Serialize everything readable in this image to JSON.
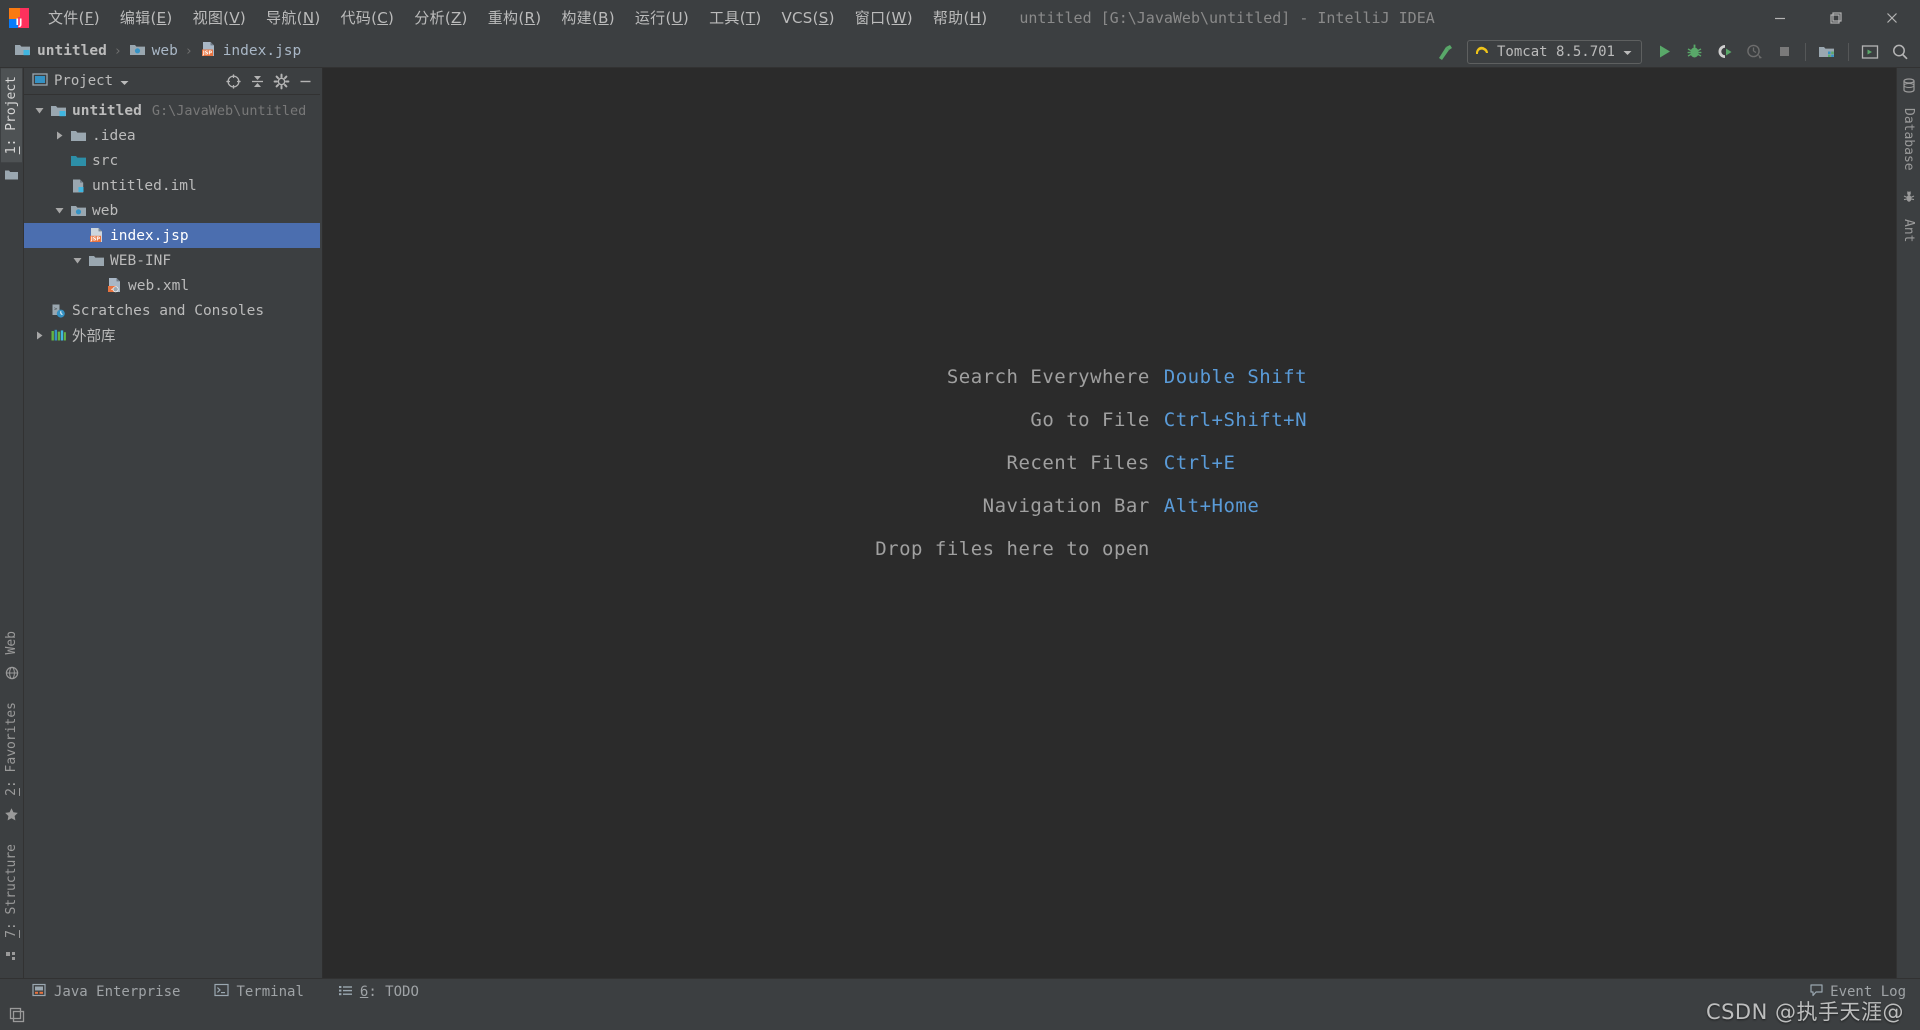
{
  "colors": {
    "chrome": "#3c3f41",
    "editor_bg": "#2b2b2b",
    "selection": "#4b6eaf",
    "text": "#bbbbbb",
    "muted": "#787878",
    "accent_blue": "#5a9bd8",
    "run_green": "#59a869"
  },
  "menubar": {
    "items": [
      {
        "label": "文件",
        "mnemonic": "F"
      },
      {
        "label": "编辑",
        "mnemonic": "E"
      },
      {
        "label": "视图",
        "mnemonic": "V"
      },
      {
        "label": "导航",
        "mnemonic": "N"
      },
      {
        "label": "代码",
        "mnemonic": "C"
      },
      {
        "label": "分析",
        "mnemonic": "Z"
      },
      {
        "label": "重构",
        "mnemonic": "R"
      },
      {
        "label": "构建",
        "mnemonic": "B"
      },
      {
        "label": "运行",
        "mnemonic": "U"
      },
      {
        "label": "工具",
        "mnemonic": "T"
      },
      {
        "label": "VCS",
        "mnemonic": "S"
      },
      {
        "label": "窗口",
        "mnemonic": "W"
      },
      {
        "label": "帮助",
        "mnemonic": "H"
      }
    ],
    "window_title": "untitled [G:\\JavaWeb\\untitled] - IntelliJ IDEA",
    "window_controls": [
      "minimize-icon",
      "restore-icon",
      "close-icon"
    ]
  },
  "navbar": {
    "breadcrumbs": [
      {
        "label": "untitled",
        "icon": "module-folder-icon",
        "bold": true
      },
      {
        "label": "web",
        "icon": "web-folder-icon",
        "bold": false
      },
      {
        "label": "index.jsp",
        "icon": "jsp-file-icon",
        "bold": false
      }
    ],
    "separator": "›",
    "toolbar": {
      "build_label": "build-hammer-icon",
      "run_config": {
        "name": "Tomcat 8.5.701",
        "icon": "tomcat-cat-icon",
        "chevron": "chevron-down-icon"
      },
      "buttons": [
        {
          "name": "run-button",
          "icon": "run-play-icon",
          "enabled": true
        },
        {
          "name": "debug-button",
          "icon": "debug-bug-icon",
          "enabled": true
        },
        {
          "name": "run-with-coverage-button",
          "icon": "coverage-icon",
          "enabled": true
        },
        {
          "name": "profile-button",
          "icon": "profiler-icon",
          "enabled": false
        },
        {
          "name": "stop-button",
          "icon": "stop-square-icon",
          "enabled": false
        },
        {
          "name": "project-structure-button",
          "icon": "project-structure-icon",
          "enabled": true
        },
        {
          "name": "terminal-button",
          "icon": "terminal-window-icon",
          "enabled": true
        },
        {
          "name": "search-everywhere-button",
          "icon": "search-icon",
          "enabled": true
        }
      ]
    }
  },
  "left_strip": {
    "top": [
      {
        "label": "1: Project",
        "mnemonic": "1",
        "icon": "project-folder-icon",
        "active": true
      }
    ],
    "bottom": [
      {
        "label": "7: Structure",
        "mnemonic": "7",
        "icon": "structure-icon",
        "active": false
      },
      {
        "label": "2: Favorites",
        "mnemonic": "2",
        "icon": "star-icon",
        "active": false
      },
      {
        "label": "Web",
        "mnemonic": "",
        "icon": "web-globe-icon",
        "active": false
      }
    ]
  },
  "right_strip": {
    "top": [
      {
        "label": "Database",
        "icon": "database-icon",
        "active": false
      },
      {
        "label": "Ant",
        "icon": "ant-icon",
        "active": false
      }
    ]
  },
  "project_panel": {
    "title": "Project",
    "chevron": "chevron-down-icon",
    "actions": [
      {
        "name": "scroll-from-source-button",
        "icon": "target-crosshair-icon"
      },
      {
        "name": "collapse-all-button",
        "icon": "collapse-all-icon"
      },
      {
        "name": "settings-button",
        "icon": "gear-icon"
      },
      {
        "name": "hide-panel-button",
        "icon": "minimize-dash-icon"
      }
    ],
    "tree": [
      {
        "label": "untitled",
        "sub": "G:\\JavaWeb\\untitled",
        "icon": "module-folder-icon",
        "indent": 0,
        "twist": "expanded",
        "bold": true,
        "selected": false
      },
      {
        "label": ".idea",
        "sub": "",
        "icon": "folder-icon",
        "indent": 1,
        "twist": "collapsed",
        "bold": false,
        "selected": false
      },
      {
        "label": "src",
        "sub": "",
        "icon": "source-folder-icon",
        "indent": 1,
        "twist": "none",
        "bold": false,
        "selected": false
      },
      {
        "label": "untitled.iml",
        "sub": "",
        "icon": "iml-file-icon",
        "indent": 1,
        "twist": "none",
        "bold": false,
        "selected": false
      },
      {
        "label": "web",
        "sub": "",
        "icon": "web-folder-icon",
        "indent": 1,
        "twist": "expanded",
        "bold": false,
        "selected": false
      },
      {
        "label": "index.jsp",
        "sub": "",
        "icon": "jsp-file-icon",
        "indent": 2,
        "twist": "none",
        "bold": false,
        "selected": true
      },
      {
        "label": "WEB-INF",
        "sub": "",
        "icon": "folder-icon",
        "indent": 2,
        "twist": "expanded",
        "bold": false,
        "selected": false
      },
      {
        "label": "web.xml",
        "sub": "",
        "icon": "xml-file-icon",
        "indent": 3,
        "twist": "none",
        "bold": false,
        "selected": false
      },
      {
        "label": "Scratches and Consoles",
        "sub": "",
        "icon": "scratches-icon",
        "indent": 0,
        "twist": "none",
        "bold": false,
        "selected": false
      },
      {
        "label": "外部库",
        "sub": "",
        "icon": "external-libraries-icon",
        "indent": 0,
        "twist": "collapsed",
        "bold": false,
        "selected": false
      }
    ]
  },
  "editor": {
    "hints": [
      {
        "label": "Search Everywhere",
        "key": "Double Shift"
      },
      {
        "label": "Go to File",
        "key": "Ctrl+Shift+N"
      },
      {
        "label": "Recent Files",
        "key": "Ctrl+E"
      },
      {
        "label": "Navigation Bar",
        "key": "Alt+Home"
      },
      {
        "label": "Drop files here to open",
        "key": ""
      }
    ]
  },
  "bottom_bar": {
    "buttons": [
      {
        "label": "Java Enterprise",
        "mnemonic": "",
        "icon": "java-enterprise-icon"
      },
      {
        "label": "Terminal",
        "mnemonic": "",
        "icon": "terminal-icon"
      },
      {
        "label": "6: TODO",
        "mnemonic": "6",
        "icon": "todo-list-icon"
      }
    ],
    "event_log": {
      "label": "Event Log",
      "icon": "event-log-icon"
    }
  },
  "status_bar": {
    "toggle_icon": "toggle-toolwindows-icon"
  },
  "watermark": "CSDN @执手天涯@"
}
